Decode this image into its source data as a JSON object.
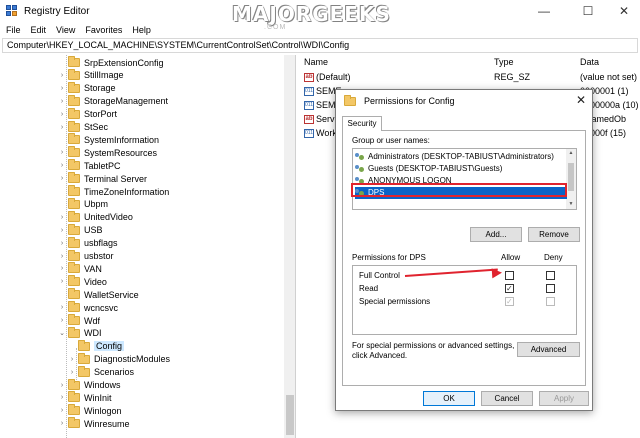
{
  "window": {
    "title": "Registry Editor",
    "watermark": "MAJORGEEKS",
    "watermark_sub": ".COM",
    "minimize_glyph": "—",
    "maximize_glyph": "☐",
    "close_glyph": "✕"
  },
  "menu": [
    "File",
    "Edit",
    "View",
    "Favorites",
    "Help"
  ],
  "address": "Computer\\HKEY_LOCAL_MACHINE\\SYSTEM\\CurrentControlSet\\Control\\WDI\\Config",
  "tree": [
    {
      "label": "SrpExtensionConfig",
      "level": 1,
      "chev": ""
    },
    {
      "label": "StillImage",
      "level": 1,
      "chev": "›"
    },
    {
      "label": "Storage",
      "level": 1,
      "chev": "›"
    },
    {
      "label": "StorageManagement",
      "level": 1,
      "chev": "›"
    },
    {
      "label": "StorPort",
      "level": 1,
      "chev": "›"
    },
    {
      "label": "StSec",
      "level": 1,
      "chev": "›"
    },
    {
      "label": "SystemInformation",
      "level": 1,
      "chev": ""
    },
    {
      "label": "SystemResources",
      "level": 1,
      "chev": "›"
    },
    {
      "label": "TabletPC",
      "level": 1,
      "chev": "›"
    },
    {
      "label": "Terminal Server",
      "level": 1,
      "chev": "›"
    },
    {
      "label": "TimeZoneInformation",
      "level": 1,
      "chev": ""
    },
    {
      "label": "Ubpm",
      "level": 1,
      "chev": ""
    },
    {
      "label": "UnitedVideo",
      "level": 1,
      "chev": "›"
    },
    {
      "label": "USB",
      "level": 1,
      "chev": "›"
    },
    {
      "label": "usbflags",
      "level": 1,
      "chev": "›"
    },
    {
      "label": "usbstor",
      "level": 1,
      "chev": "›"
    },
    {
      "label": "VAN",
      "level": 1,
      "chev": "›"
    },
    {
      "label": "Video",
      "level": 1,
      "chev": "›"
    },
    {
      "label": "WalletService",
      "level": 1,
      "chev": ""
    },
    {
      "label": "wcncsvc",
      "level": 1,
      "chev": "›"
    },
    {
      "label": "Wdf",
      "level": 1,
      "chev": "›"
    },
    {
      "label": "WDI",
      "level": 1,
      "chev": "⌄"
    },
    {
      "label": "Config",
      "level": 2,
      "chev": "",
      "selected": true
    },
    {
      "label": "DiagnosticModules",
      "level": 2,
      "chev": "›"
    },
    {
      "label": "Scenarios",
      "level": 2,
      "chev": "›"
    },
    {
      "label": "Windows",
      "level": 1,
      "chev": "›"
    },
    {
      "label": "WinInit",
      "level": 1,
      "chev": "›"
    },
    {
      "label": "Winlogon",
      "level": 1,
      "chev": "›"
    },
    {
      "label": "Winresume",
      "level": 1,
      "chev": "›"
    }
  ],
  "list": {
    "headers": {
      "name": "Name",
      "type": "Type",
      "data": "Data"
    },
    "rows": [
      {
        "icon": "ab",
        "name": "(Default)",
        "type": "REG_SZ",
        "data": "(value not set)"
      },
      {
        "icon": "bin",
        "name": "SEME",
        "type": "",
        "data": "0000001 (1)"
      },
      {
        "icon": "bin",
        "name": "SEMT",
        "type": "",
        "data": "0000000a (10)"
      },
      {
        "icon": "ab",
        "name": "Serv",
        "type": "",
        "data": "eNamedOb"
      },
      {
        "icon": "bin",
        "name": "Work",
        "type": "",
        "data": "00000f (15)"
      }
    ]
  },
  "dialog": {
    "title": "Permissions for Config",
    "close_glyph": "✕",
    "tab": "Security",
    "group_label": "Group or user names:",
    "users": [
      "Administrators (DESKTOP-TABIUST\\Administrators)",
      "Guests (DESKTOP-TABIUST\\Guests)",
      "ANONYMOUS LOGON",
      "DPS"
    ],
    "selected_user_index": 3,
    "add_label": "Add...",
    "remove_label": "Remove",
    "perm_label": "Permissions for DPS",
    "allow_label": "Allow",
    "deny_label": "Deny",
    "permissions": [
      {
        "name": "Full Control",
        "allow": false,
        "deny": false,
        "grey": false
      },
      {
        "name": "Read",
        "allow": true,
        "deny": false,
        "grey": false
      },
      {
        "name": "Special permissions",
        "allow": true,
        "deny": false,
        "grey": true
      }
    ],
    "advanced_text": "For special permissions or advanced settings, click Advanced.",
    "advanced_label": "Advanced",
    "ok_label": "OK",
    "cancel_label": "Cancel",
    "apply_label": "Apply"
  },
  "colors": {
    "selection": "#0a64c8",
    "highlight_box": "#e0232e",
    "annotation_arrow": "#e0232e",
    "folder": "#f3c766"
  }
}
